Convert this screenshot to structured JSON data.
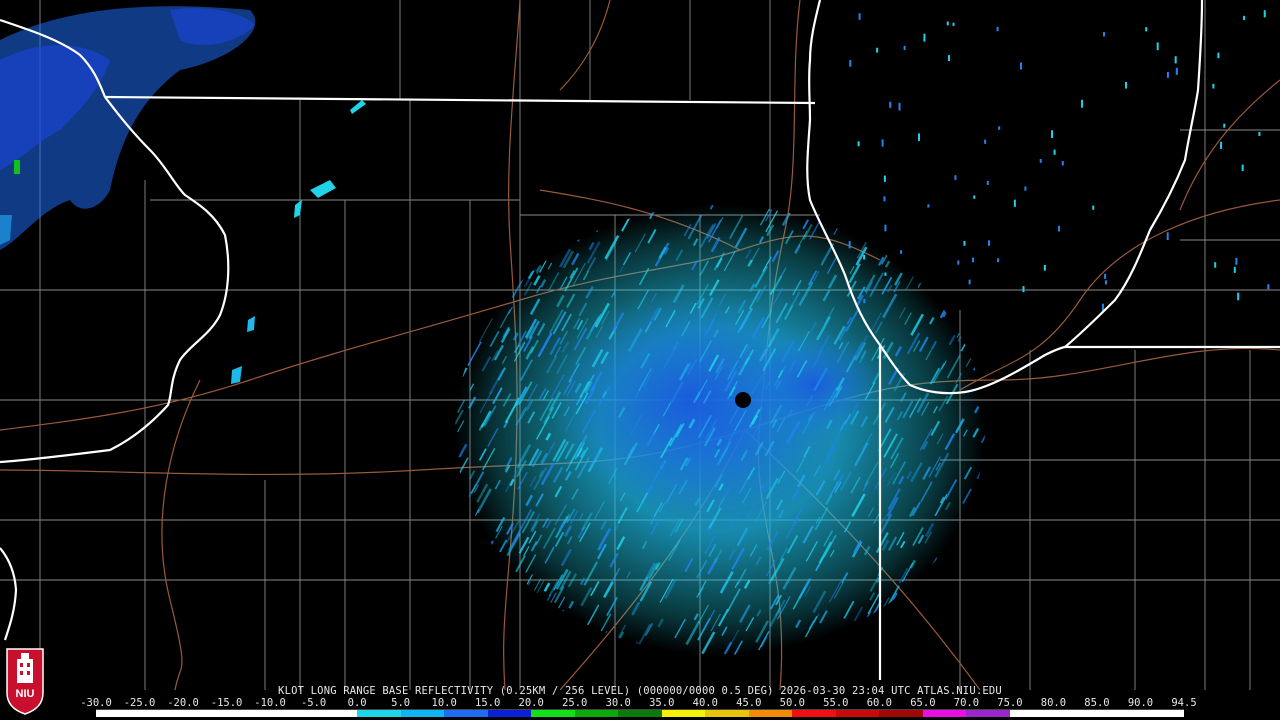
{
  "map": {
    "radar_site": "KLOT",
    "product": "LONG RANGE BASE REFLECTIVITY"
  },
  "caption": {
    "text": "KLOT LONG RANGE BASE REFLECTIVITY (0.25KM / 256 LEVEL) (000000/0000 0.5 DEG) 2026-03-30 23:04 UTC  ATLAS.NIU.EDU"
  },
  "legend": {
    "labels": [
      "-30.0",
      "-25.0",
      "-20.0",
      "-15.0",
      "-10.0",
      "-5.0",
      "0.0",
      "5.0",
      "10.0",
      "15.0",
      "20.0",
      "25.0",
      "30.0",
      "35.0",
      "40.0",
      "45.0",
      "50.0",
      "55.0",
      "60.0",
      "65.0",
      "70.0",
      "75.0",
      "80.0",
      "85.0",
      "90.0",
      "94.5"
    ],
    "colors": [
      "#ffffff",
      "#ffffff",
      "#ffffff",
      "#ffffff",
      "#ffffff",
      "#ffffff",
      "#1fd3e8",
      "#10b4f0",
      "#1e6cf0",
      "#0b1fd8",
      "#12e01a",
      "#0ca80c",
      "#0b7a0b",
      "#f5f20a",
      "#e8c40a",
      "#f08c0a",
      "#f01010",
      "#c80a0a",
      "#a00808",
      "#e810e0",
      "#9a28c8",
      "#ffffff",
      "#ffffff",
      "#ffffff",
      "#ffffff"
    ]
  },
  "logo": {
    "text": "NIU",
    "color": "#c8102e"
  },
  "colors": {
    "background": "#000000",
    "state_border": "#ffffff",
    "county_line": "#8a8a8a",
    "highway": "#9a5a3a",
    "echo_light": "#1fd3e8",
    "echo_mid": "#1e8cf0",
    "echo_strong": "#1846d8"
  }
}
